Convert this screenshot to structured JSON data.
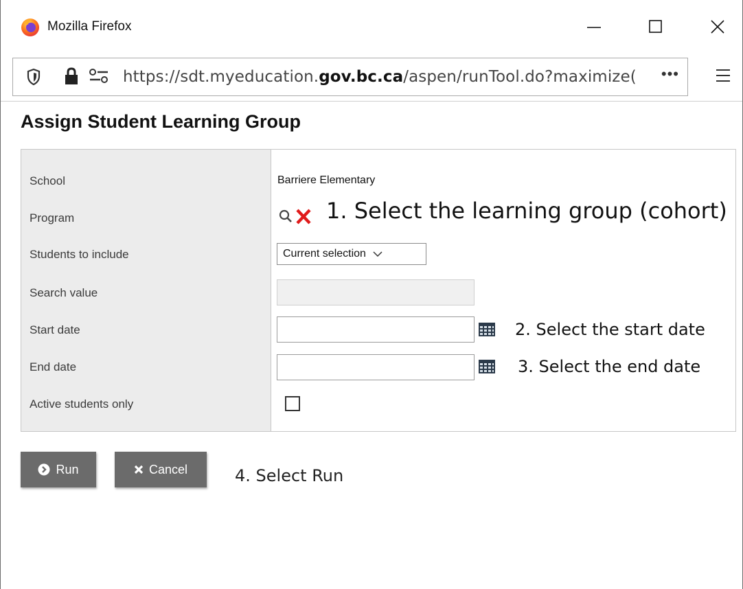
{
  "window": {
    "title": "Mozilla Firefox"
  },
  "browser": {
    "url_prefix": "https://sdt.myeducation.",
    "url_domain": "gov.bc.ca",
    "url_suffix": "/aspen/runTool.do?maximize(",
    "url_more": "•••"
  },
  "page": {
    "title": "Assign Student Learning Group"
  },
  "form": {
    "labels": {
      "school": "School",
      "program": "Program",
      "students_to_include": "Students to include",
      "search_value": "Search value",
      "start_date": "Start date",
      "end_date": "End date",
      "active_students_only": "Active students only"
    },
    "school_value": "Barriere Elementary",
    "students_to_include_selected": "Current selection",
    "search_value": "",
    "start_date_value": "",
    "end_date_value": "",
    "active_students_only_checked": false
  },
  "buttons": {
    "run_label": "Run",
    "cancel_label": "Cancel"
  },
  "annotations": {
    "step1": "1. Select the learning group (cohort)",
    "step2": "2. Select the start date",
    "step3": "3. Select the end date",
    "step4": "4. Select Run"
  },
  "icons": {
    "logo": "firefox-logo",
    "shield": "shield-icon",
    "lock": "lock-icon",
    "permissions": "permissions-icon",
    "menu": "hamburger-menu-icon",
    "search": "search-icon",
    "clear": "clear-x-icon",
    "calendar": "calendar-icon",
    "run": "play-circle-icon",
    "cancel": "x-icon"
  },
  "colors": {
    "button_bg": "#6b6b6b",
    "label_col_bg": "#ececec",
    "clear_icon": "#e01a1a"
  }
}
